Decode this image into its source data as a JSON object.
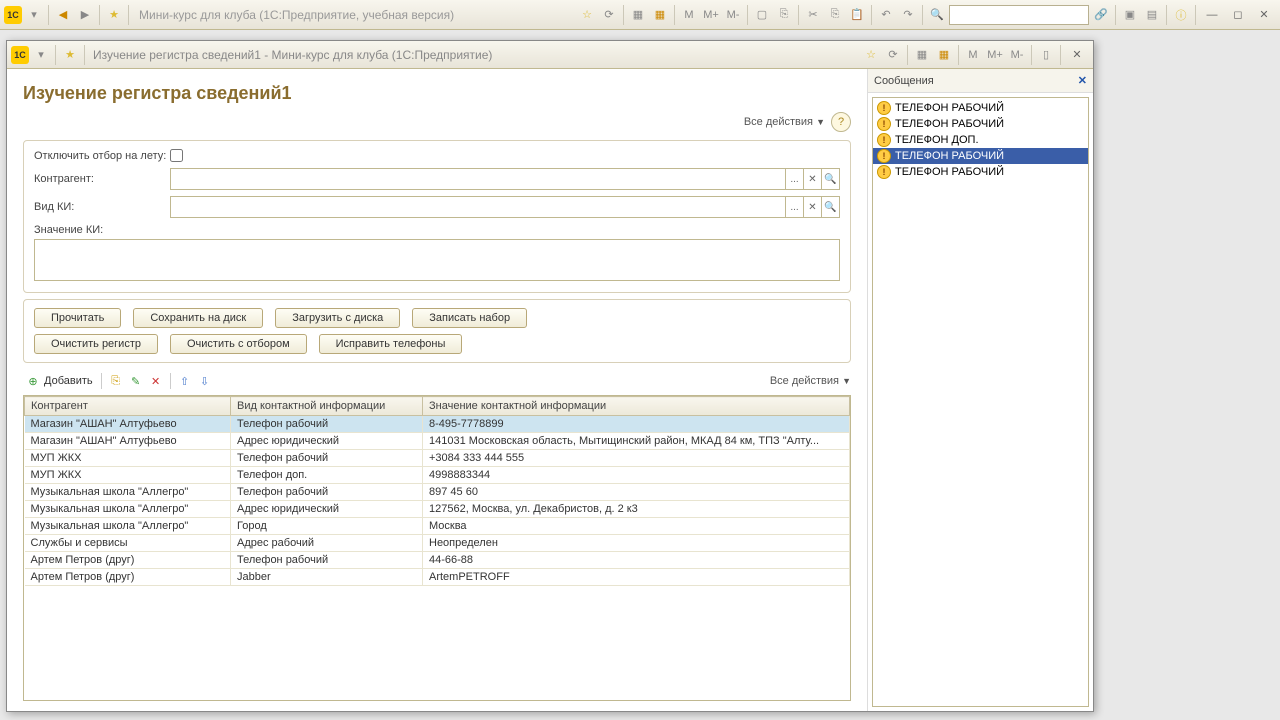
{
  "main_toolbar": {
    "title": "Мини-курс для клуба  (1С:Предприятие, учебная версия)"
  },
  "child": {
    "title": "Изучение регистра сведений1 - Мини-курс для клуба  (1С:Предприятие)"
  },
  "page": {
    "title": "Изучение регистра сведений1",
    "all_actions": "Все действия",
    "filters": {
      "disable_filter_label": "Отключить отбор на лету:",
      "contractor_label": "Контрагент:",
      "contractor_value": "",
      "ci_type_label": "Вид КИ:",
      "ci_type_value": "",
      "ci_value_label": "Значение КИ:",
      "ci_value_value": ""
    },
    "buttons": {
      "read": "Прочитать",
      "save_disk": "Сохранить на диск",
      "load_disk": "Загрузить с диска",
      "write_set": "Записать набор",
      "clear_register": "Очистить регистр",
      "clear_filtered": "Очистить с отбором",
      "fix_phones": "Исправить телефоны"
    },
    "table_toolbar": {
      "add": "Добавить",
      "all_actions": "Все действия"
    },
    "grid": {
      "headers": [
        "Контрагент",
        "Вид контактной информации",
        "Значение контактной информации"
      ],
      "rows": [
        [
          "Магазин \"АШАН\" Алтуфьево",
          "Телефон рабочий",
          "8-495-7778899"
        ],
        [
          "Магазин \"АШАН\" Алтуфьево",
          "Адрес юридический",
          "141031 Московская область, Мытищинский район, МКАД 84 км, ТПЗ \"Алту..."
        ],
        [
          "МУП ЖКХ",
          "Телефон рабочий",
          "+3084 333 444 555"
        ],
        [
          "МУП ЖКХ",
          "Телефон доп.",
          "4998883344"
        ],
        [
          "Музыкальная школа \"Аллегро\"",
          "Телефон рабочий",
          "897 45 60"
        ],
        [
          "Музыкальная школа \"Аллегро\"",
          "Адрес юридический",
          "127562, Москва, ул. Декабристов, д. 2 к3"
        ],
        [
          "Музыкальная школа \"Аллегро\"",
          "Город",
          "Москва"
        ],
        [
          "Службы и сервисы",
          "Адрес рабочий",
          "Неопределен"
        ],
        [
          "Артем Петров (друг)",
          "Телефон рабочий",
          "44-66-88"
        ],
        [
          "Артем Петров (друг)",
          "Jabber",
          "ArtemPETROFF"
        ]
      ],
      "selected_row": 0
    }
  },
  "messages": {
    "title": "Сообщения",
    "items": [
      "ТЕЛЕФОН РАБОЧИЙ",
      "ТЕЛЕФОН РАБОЧИЙ",
      "ТЕЛЕФОН ДОП.",
      "ТЕЛЕФОН РАБОЧИЙ",
      "ТЕЛЕФОН РАБОЧИЙ"
    ],
    "selected": 3
  }
}
